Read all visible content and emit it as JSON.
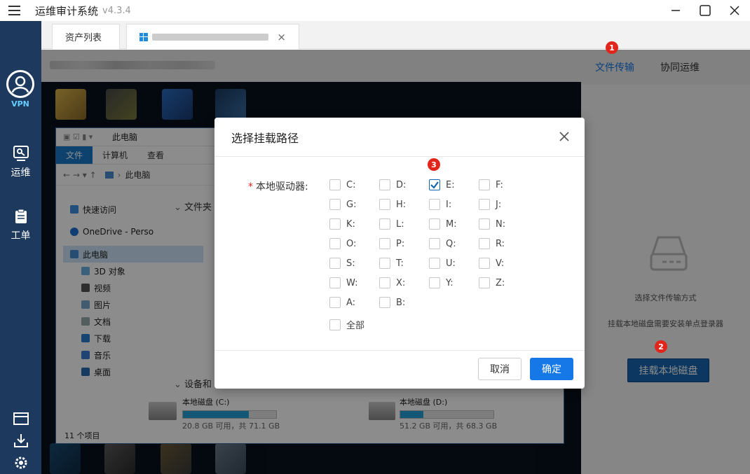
{
  "app": {
    "title": "运维审计系统",
    "version": "v4.3.4"
  },
  "leftnav": {
    "vpn_label": "VPN",
    "items": [
      {
        "label": "运维"
      },
      {
        "label": "工单"
      }
    ]
  },
  "tabs": [
    {
      "label": "资产列表"
    },
    {
      "label": "",
      "close": "×"
    }
  ],
  "explorer": {
    "title": "此电脑",
    "ribbon": [
      "文件",
      "计算机",
      "查看"
    ],
    "address": "此电脑",
    "sidebar": [
      "快速访问",
      "OneDrive - Perso",
      "此电脑",
      "3D 对象",
      "视频",
      "图片",
      "文档",
      "下载",
      "音乐",
      "桌面"
    ],
    "section_folders": "文件夹",
    "section_devices": "设备和",
    "drives": [
      {
        "name": "本地磁盘 (C:)",
        "info": "20.8 GB 可用，共 71.1 GB",
        "used_fraction": 0.71
      },
      {
        "name": "本地磁盘 (D:)",
        "info": "51.2 GB 可用，共 68.3 GB",
        "used_fraction": 0.25
      }
    ],
    "status": "11 个项目"
  },
  "right_panel": {
    "tabs": [
      "文件传输",
      "协同运维"
    ],
    "desc1": "选择文件传输方式",
    "desc2": "挂载本地磁盘需要安装单点登录器",
    "mount_button": "挂载本地磁盘"
  },
  "badges": [
    "1",
    "2",
    "3"
  ],
  "dialog": {
    "title": "选择挂载路径",
    "field_label": "本地驱动器:",
    "required_mark": "*",
    "drives": [
      {
        "label": "C:",
        "checked": false
      },
      {
        "label": "D:",
        "checked": false
      },
      {
        "label": "E:",
        "checked": true
      },
      {
        "label": "F:",
        "checked": false
      },
      {
        "label": "G:",
        "checked": false
      },
      {
        "label": "H:",
        "checked": false
      },
      {
        "label": "I:",
        "checked": false
      },
      {
        "label": "J:",
        "checked": false
      },
      {
        "label": "K:",
        "checked": false
      },
      {
        "label": "L:",
        "checked": false
      },
      {
        "label": "M:",
        "checked": false
      },
      {
        "label": "N:",
        "checked": false
      },
      {
        "label": "O:",
        "checked": false
      },
      {
        "label": "P:",
        "checked": false
      },
      {
        "label": "Q:",
        "checked": false
      },
      {
        "label": "R:",
        "checked": false
      },
      {
        "label": "S:",
        "checked": false
      },
      {
        "label": "T:",
        "checked": false
      },
      {
        "label": "U:",
        "checked": false
      },
      {
        "label": "V:",
        "checked": false
      },
      {
        "label": "W:",
        "checked": false
      },
      {
        "label": "X:",
        "checked": false
      },
      {
        "label": "Y:",
        "checked": false
      },
      {
        "label": "Z:",
        "checked": false
      },
      {
        "label": "A:",
        "checked": false
      },
      {
        "label": "B:",
        "checked": false
      }
    ],
    "select_all": "全部",
    "cancel": "取消",
    "confirm": "确定"
  },
  "colors": {
    "nav_bg": "#1d3a5e",
    "primary": "#1677e6",
    "badge": "#e0251b",
    "mount_button": "#1565b0"
  }
}
